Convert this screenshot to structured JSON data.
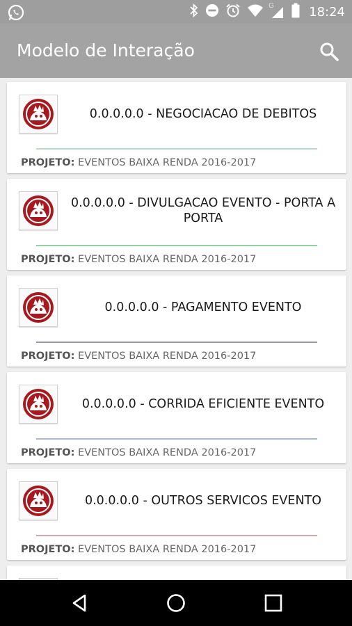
{
  "status_bar": {
    "time": "18:24",
    "network_letter": "G",
    "icons": [
      "whatsapp-icon",
      "bluetooth-icon",
      "do-not-disturb-icon",
      "alarm-icon",
      "wifi-icon",
      "signal-icon",
      "battery-icon"
    ]
  },
  "app_bar": {
    "title": "Modelo de Interação",
    "search_icon": "search-icon"
  },
  "cards": [
    {
      "title": "0.0.0.0.0 - NEGOCIACAO DE DEBITOS",
      "project_label": "PROJETO:",
      "project_value": "EVENTOS BAIXA RENDA 2016-2017",
      "divider_color": "#b9dcc6"
    },
    {
      "title": "0.0.0.0.0 - DIVULGACAO EVENTO - PORTA A PORTA",
      "project_label": "PROJETO:",
      "project_value": "EVENTOS BAIXA RENDA 2016-2017",
      "divider_color": "#8fd3a0"
    },
    {
      "title": "0.0.0.0.0 - PAGAMENTO EVENTO",
      "project_label": "PROJETO:",
      "project_value": "EVENTOS BAIXA RENDA 2016-2017",
      "divider_color": "#9a97bc"
    },
    {
      "title": "0.0.0.0.0 - CORRIDA EFICIENTE EVENTO",
      "project_label": "PROJETO:",
      "project_value": "EVENTOS BAIXA RENDA 2016-2017",
      "divider_color": "#a9b7d6"
    },
    {
      "title": "0.0.0.0.0 - OUTROS SERVICOS EVENTO",
      "project_label": "PROJETO:",
      "project_value": "EVENTOS BAIXA RENDA 2016-2017",
      "divider_color": "#d6a7a7"
    }
  ],
  "colors": {
    "app_bar": "#a3a3a3",
    "status_bar": "#9e9e9e",
    "logo_red": "#a8191f"
  },
  "nav_bar": {
    "icons": [
      "back-icon",
      "home-icon",
      "recents-icon"
    ]
  }
}
